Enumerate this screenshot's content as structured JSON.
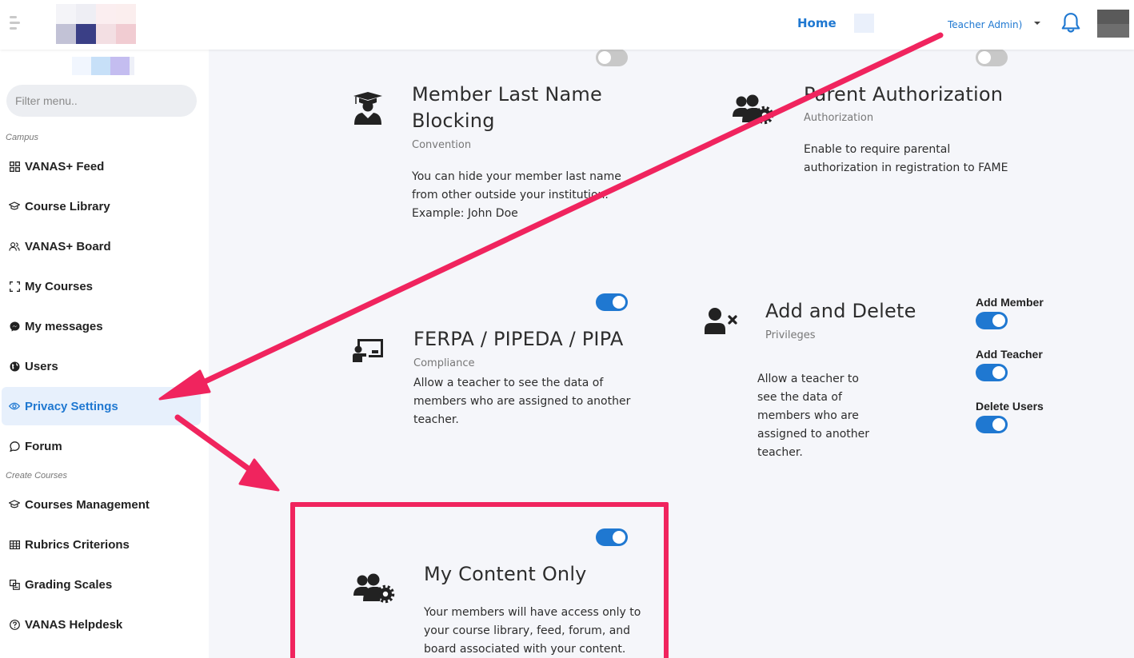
{
  "header": {
    "nav_home": "Home",
    "user_name": "Teacher Admin)",
    "accent_color": "#1f78d1"
  },
  "sidebar": {
    "filter_placeholder": "Filter menu..",
    "section_campus": "Campus",
    "section_create": "Create Courses",
    "items": [
      {
        "label": "VANAS+ Feed",
        "icon": "grid-icon"
      },
      {
        "label": "Course Library",
        "icon": "graduation-cap-icon"
      },
      {
        "label": "VANAS+ Board",
        "icon": "users-icon"
      },
      {
        "label": "My Courses",
        "icon": "frame-icon"
      },
      {
        "label": "My messages",
        "icon": "messenger-icon"
      },
      {
        "label": "Users",
        "icon": "globe-icon"
      },
      {
        "label": "Privacy Settings",
        "icon": "eye-icon",
        "active": true
      },
      {
        "label": "Forum",
        "icon": "chat-bubble-icon"
      },
      {
        "label": "Courses Management",
        "icon": "graduation-cap-icon"
      },
      {
        "label": "Rubrics Criterions",
        "icon": "table-icon"
      },
      {
        "label": "Grading Scales",
        "icon": "scale-icon"
      },
      {
        "label": "VANAS Helpdesk",
        "icon": "question-circle-icon"
      }
    ]
  },
  "cards": {
    "last_name": {
      "title_line1": "Member Last Name",
      "title_line2": "Blocking",
      "subtitle": "Convention",
      "desc_line1": "You can hide your member last name",
      "desc_line2": "from other outside your institution.",
      "desc_line3": "Example: John Doe",
      "toggle_on": false
    },
    "parent_auth": {
      "title": "Parent Authorization",
      "subtitle": "Authorization",
      "desc_line1": "Enable to require parental",
      "desc_line2": "authorization in registration to FAME",
      "toggle_on": false
    },
    "ferpa": {
      "title": "FERPA / PIPEDA / PIPA",
      "subtitle": "Compliance",
      "desc_line1": "Allow a teacher to see the data of",
      "desc_line2": "members who are assigned to another",
      "desc_line3": "teacher.",
      "toggle_on": true
    },
    "add_delete": {
      "title": "Add and Delete",
      "subtitle": "Privileges",
      "desc_line1": "Allow a teacher to",
      "desc_line2": "see the data of",
      "desc_line3": "members who are",
      "desc_line4": "assigned to another",
      "desc_line5": "teacher.",
      "privileges": [
        {
          "label": "Add Member",
          "on": true
        },
        {
          "label": "Add Teacher",
          "on": true
        },
        {
          "label": "Delete Users",
          "on": true
        }
      ]
    },
    "my_content": {
      "title": "My Content Only",
      "desc_line1": "Your members will have access only to",
      "desc_line2": "your course library, feed, forum, and",
      "desc_line3": "board associated with your content.",
      "toggle_on": true
    }
  },
  "annotation": {
    "color": "#f0245e"
  }
}
